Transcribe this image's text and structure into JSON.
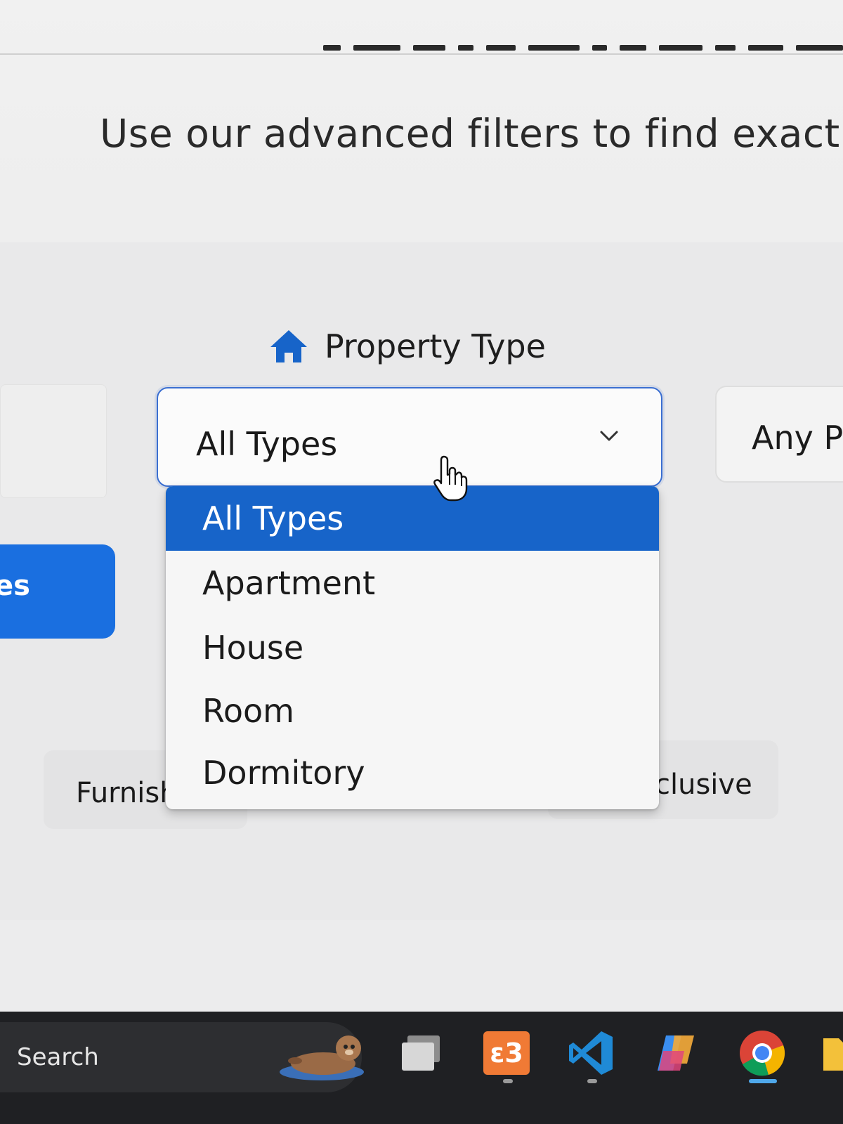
{
  "page": {
    "subtitle": "Use our advanced filters to find exactly"
  },
  "filters": {
    "property_type": {
      "label": "Property Type",
      "selected": "All Types",
      "options": [
        "All Types",
        "Apartment",
        "House",
        "Room",
        "Dormitory"
      ]
    },
    "price": {
      "selected": "Any Pr"
    },
    "button_fragment": "es",
    "chips": {
      "furnish_fragment": "Furnish",
      "exclusive_fragment": "clusive"
    }
  },
  "taskbar": {
    "search_label": "Search",
    "apps": [
      "task-view-icon",
      "xampp-icon",
      "vscode-icon",
      "copilot-icon",
      "chrome-icon",
      "file-explorer-icon"
    ]
  },
  "colors": {
    "accent": "#1764c9",
    "button_blue": "#1a6fe0",
    "focus_border": "#3b6fd1"
  }
}
